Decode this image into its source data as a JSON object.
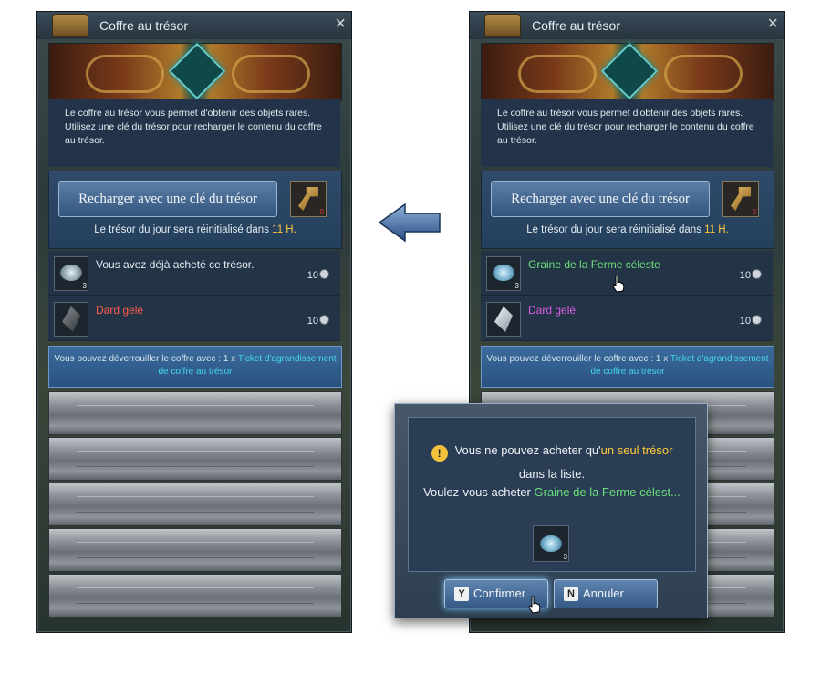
{
  "left_panel": {
    "title": "Coffre au trésor",
    "description": "Le coffre au trésor vous permet d'obtenir des objets rares. Utilisez une clé du trésor pour recharger le contenu du coffre au trésor.",
    "recharge_button": "Recharger avec une clé du trésor",
    "key_count": "0",
    "reset_prefix": "Le trésor du jour sera réinitialisé dans",
    "reset_value": "11  H.",
    "items": [
      {
        "name": "Vous avez déjà acheté ce trésor.",
        "price": "10",
        "color": "#e6ecf1",
        "stack": "3"
      },
      {
        "name": "Dard gelé",
        "price": "10",
        "color": "#ff5a4a",
        "stack": ""
      }
    ],
    "unlock_prefix": "Vous pouvez déverrouiller le coffre avec : 1 x",
    "unlock_link": "Ticket d'agrandissement de coffre au trésor"
  },
  "right_panel": {
    "title": "Coffre au trésor",
    "description": "Le coffre au trésor vous permet d'obtenir des objets rares. Utilisez une clé du trésor pour recharger le contenu du coffre au trésor.",
    "recharge_button": "Recharger avec une clé du trésor",
    "key_count": "0",
    "reset_prefix": "Le trésor du jour sera réinitialisé dans",
    "reset_value": "11  H.",
    "items": [
      {
        "name": "Graine de la Ferme céleste",
        "price": "10",
        "color": "#6ee07a",
        "stack": "3"
      },
      {
        "name": "Dard gelé",
        "price": "10",
        "color": "#d95ce0",
        "stack": ""
      }
    ],
    "unlock_prefix": "Vous pouvez déverrouiller le coffre avec : 1 x",
    "unlock_link": "Ticket d'agrandissement de coffre au trésor"
  },
  "dialog": {
    "line1_prefix": "Vous ne pouvez acheter qu'",
    "line1_highlight": "un seul trésor",
    "line2": "dans la liste.",
    "line3_prefix": "Voulez-vous acheter",
    "line3_highlight": "Graine de la Ferme célest...",
    "item_stack": "3",
    "warn_symbol": "!",
    "confirm_key": "Y",
    "confirm_label": "Confirmer",
    "cancel_key": "N",
    "cancel_label": "Annuler"
  },
  "icons": {
    "close": "close-icon",
    "chest": "treasure-chest-icon",
    "key": "treasure-key-icon",
    "coin": "coin-icon",
    "arrow": "left-arrow-icon",
    "warning": "warning-icon",
    "cursor": "hand-cursor-icon"
  },
  "colors": {
    "highlight_yellow": "#ffc73a",
    "link_cyan": "#46d7f2",
    "item_green": "#6ee07a",
    "item_red": "#ff5a4a",
    "item_purple": "#d95ce0"
  }
}
